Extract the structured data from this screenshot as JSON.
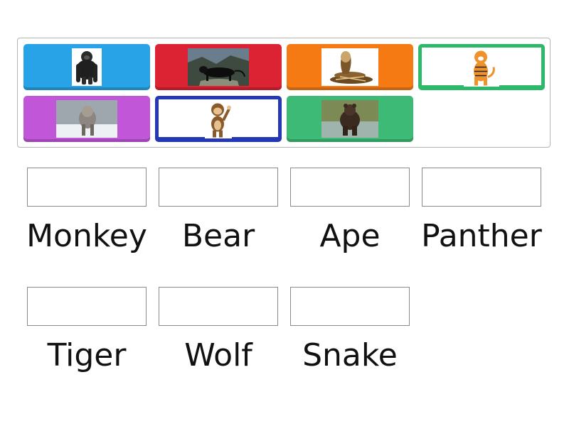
{
  "tiles": [
    {
      "name": "gorilla",
      "color": "#29a3e8"
    },
    {
      "name": "panther",
      "color": "#dc2334"
    },
    {
      "name": "cobra",
      "color": "#f67a14"
    },
    {
      "name": "tiger",
      "color": "#2eb86a"
    },
    {
      "name": "wolf",
      "color": "#c156d8"
    },
    {
      "name": "monkey",
      "color": "#2438b5"
    },
    {
      "name": "bear",
      "color": "#3dbb76"
    }
  ],
  "labels": {
    "l1": "Monkey",
    "l2": "Bear",
    "l3": "Ape",
    "l4": "Panther",
    "l5": "Tiger",
    "l6": "Wolf",
    "l7": "Snake"
  }
}
